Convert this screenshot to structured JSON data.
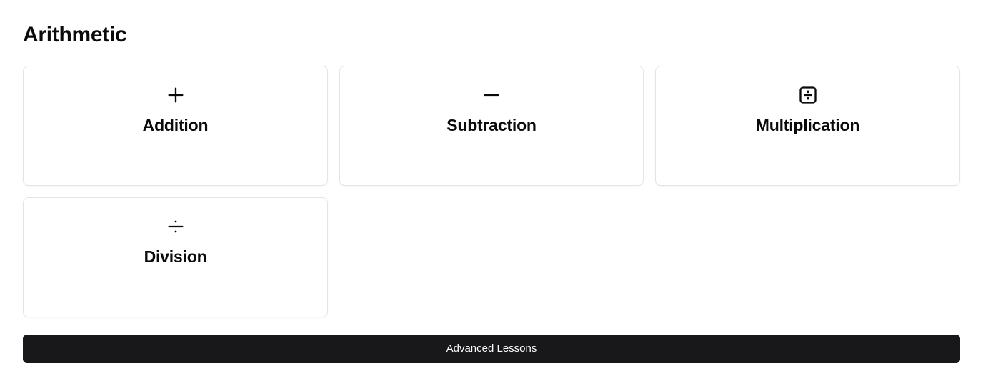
{
  "page": {
    "title": "Arithmetic"
  },
  "cards": [
    {
      "label": "Addition",
      "icon": "plus-icon"
    },
    {
      "label": "Subtraction",
      "icon": "minus-icon"
    },
    {
      "label": "Multiplication",
      "icon": "square-divide-icon"
    },
    {
      "label": "Division",
      "icon": "divide-icon"
    }
  ],
  "actions": {
    "advanced_label": "Advanced Lessons"
  },
  "colors": {
    "primary_button_bg": "#18181b",
    "primary_button_text": "#fafafa",
    "card_border": "#e4e4e7",
    "text": "#0a0a0a"
  }
}
